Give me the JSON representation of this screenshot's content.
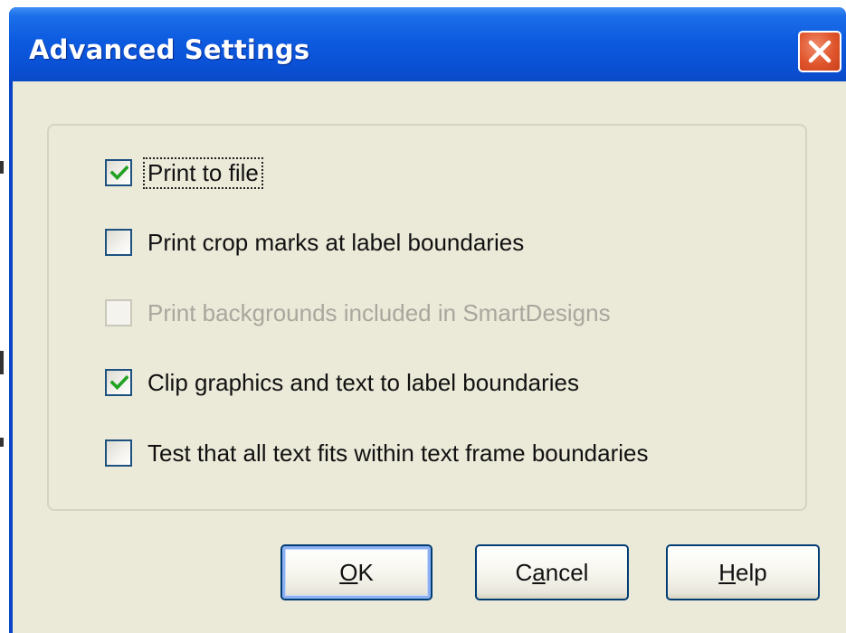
{
  "window": {
    "title": "Advanced Settings",
    "close_icon": "close-icon"
  },
  "options": [
    {
      "label": "Print to file",
      "checked": true,
      "enabled": true,
      "focused": true
    },
    {
      "label": "Print crop marks at label boundaries",
      "checked": false,
      "enabled": true,
      "focused": false
    },
    {
      "label": "Print backgrounds included in SmartDesigns",
      "checked": false,
      "enabled": false,
      "focused": false
    },
    {
      "label": "Clip graphics and text to label boundaries",
      "checked": true,
      "enabled": true,
      "focused": false
    },
    {
      "label": "Test that all text fits within text frame boundaries",
      "checked": false,
      "enabled": true,
      "focused": false
    }
  ],
  "buttons": {
    "ok": {
      "mnemonic": "O",
      "rest": "K"
    },
    "cancel": {
      "before": "C",
      "mnemonic": "a",
      "rest": "ncel"
    },
    "help": {
      "mnemonic": "H",
      "rest": "elp"
    }
  },
  "colors": {
    "titlebar": "#0a50d4",
    "close_button": "#e0552c",
    "dialog_face": "#ebe9d8",
    "check_mark": "#21a121"
  }
}
